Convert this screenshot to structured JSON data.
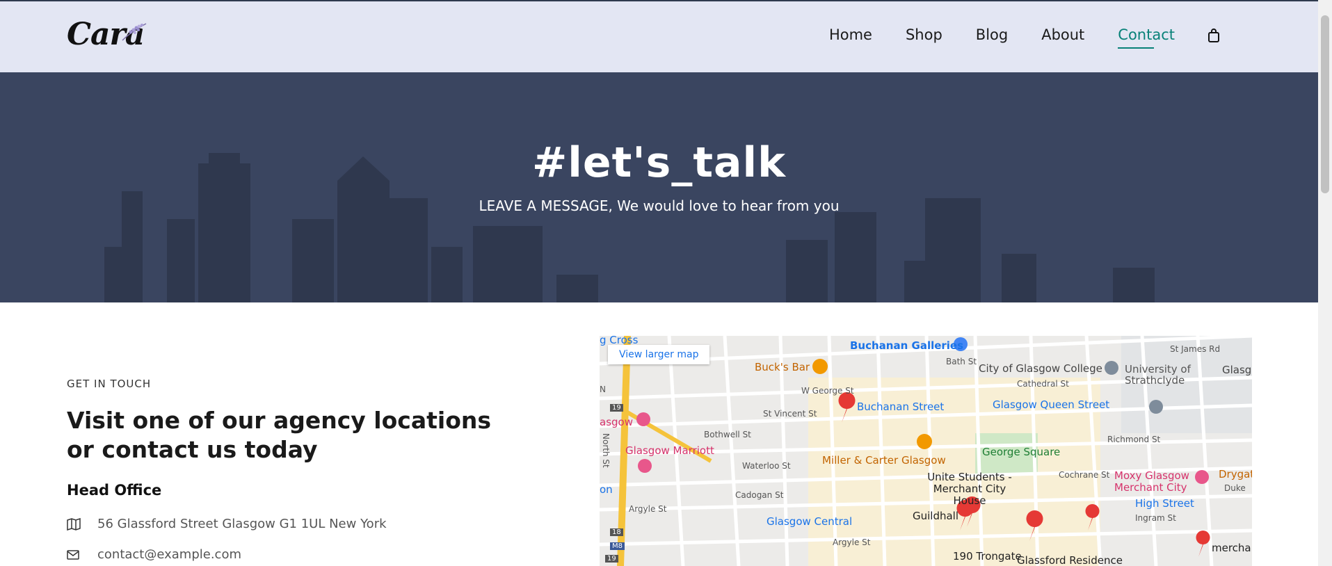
{
  "brand": {
    "logo_text": "Cara"
  },
  "nav": {
    "items": [
      {
        "label": "Home",
        "active": false
      },
      {
        "label": "Shop",
        "active": false
      },
      {
        "label": "Blog",
        "active": false
      },
      {
        "label": "About",
        "active": false
      },
      {
        "label": "Contact",
        "active": true
      }
    ],
    "cart_icon": "shopping-bag-icon"
  },
  "hero": {
    "title": "#let's_talk",
    "subtitle": "LEAVE A MESSAGE, We would love to hear from you"
  },
  "contact": {
    "eyebrow": "GET IN TOUCH",
    "headline": "Visit one of our agency locations or contact us today",
    "office_heading": "Head Office",
    "address": "56 Glassford Street Glasgow G1 1UL New York",
    "email": "contact@example.com",
    "address_icon": "map-icon",
    "email_icon": "envelope-icon"
  },
  "map": {
    "larger_map_label": "View larger map",
    "labels": {
      "buchanan_galleries": "Buchanan Galleries",
      "bucks_bar": "Buck's Bar",
      "glasgow_college": "City of Glasgow College",
      "strathclyde": "University of Strathclyde",
      "cathedral_st": "Cathedral St",
      "glasgow_queen_street": "Glasgow Queen Street",
      "buchanan_street": "Buchanan Street",
      "glasgow_marriott": "Glasgow Marriott",
      "miller_carter": "Miller & Carter Glasgow",
      "george_square": "George Square",
      "unite_students": "Unite Students - Merchant City House",
      "moxy": "Moxy Glasgow Merchant City",
      "high_street": "High Street",
      "glasgow_central": "Glasgow Central",
      "guildhall": "Guildhall",
      "argyle_st": "Argyle St",
      "trongate": "190 Trongate",
      "glassford_residence": "Glassford Residence",
      "drygate": "Drygat",
      "cross": "g Cross",
      "gow": "asgow",
      "merch": "mercha",
      "glasgow_c": "Glasgow C",
      "bath_st": "Bath St",
      "w_george_st": "W George St",
      "st_vincent_st": "St Vincent St",
      "bothwell_st": "Bothwell St",
      "waterloo_st": "Waterloo St",
      "cadogan_st": "Cadogan St",
      "richmond_st": "Richmond St",
      "cochrane_st": "Cochrane St",
      "ingram_st": "Ingram St",
      "duke": "Duke",
      "st_james_rd": "St James Rd",
      "north_st": "North St",
      "m8": "M8",
      "r18": "18",
      "r19": "19",
      "r19b": "19",
      "n": "N",
      "on": "on"
    }
  }
}
